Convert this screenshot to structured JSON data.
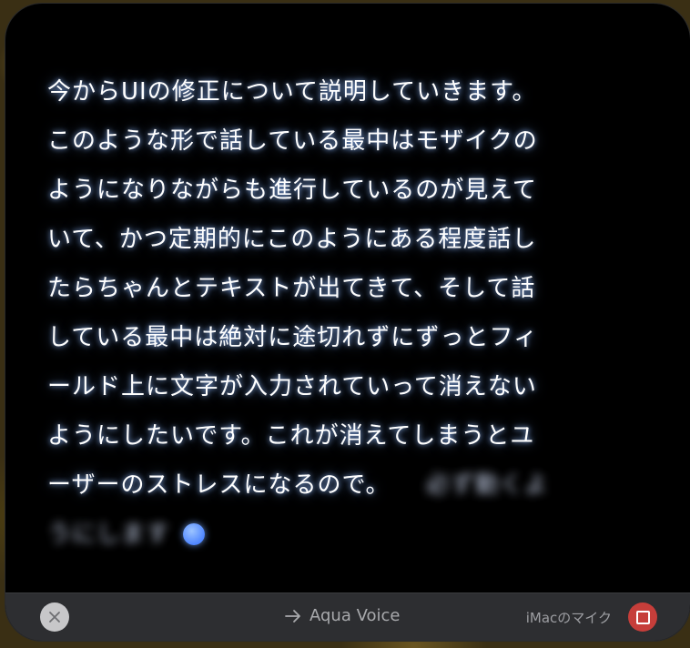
{
  "transcript": {
    "lines": [
      "今からUIの修正について説明していきます。",
      "このような形で話している最中はモザイクの",
      "ようになりながらも進行しているのが見えて",
      "いて、かつ定期的にこのようにある程度話し",
      "たらちゃんとテキストが出てきて、そして話",
      "している最中は絶対に途切れずにずっとフィ",
      "ールド上に文字が入力されていって消えない",
      "ようにしたいです。これが消えてしまうとユ",
      "ーザーのストレスになるので。"
    ],
    "pending_inline": "必ず動くよ",
    "pending_line": "うにします"
  },
  "bottombar": {
    "app_name": "Aqua Voice",
    "mic_label": "iMacのマイク"
  },
  "icons": {
    "close": "close-icon",
    "arrow": "arrow-right-icon",
    "stop": "stop-icon",
    "recording_indicator": "recording-dot-icon"
  },
  "colors": {
    "accent_blue": "#4f86ff",
    "stop_red": "#c63e3a"
  }
}
